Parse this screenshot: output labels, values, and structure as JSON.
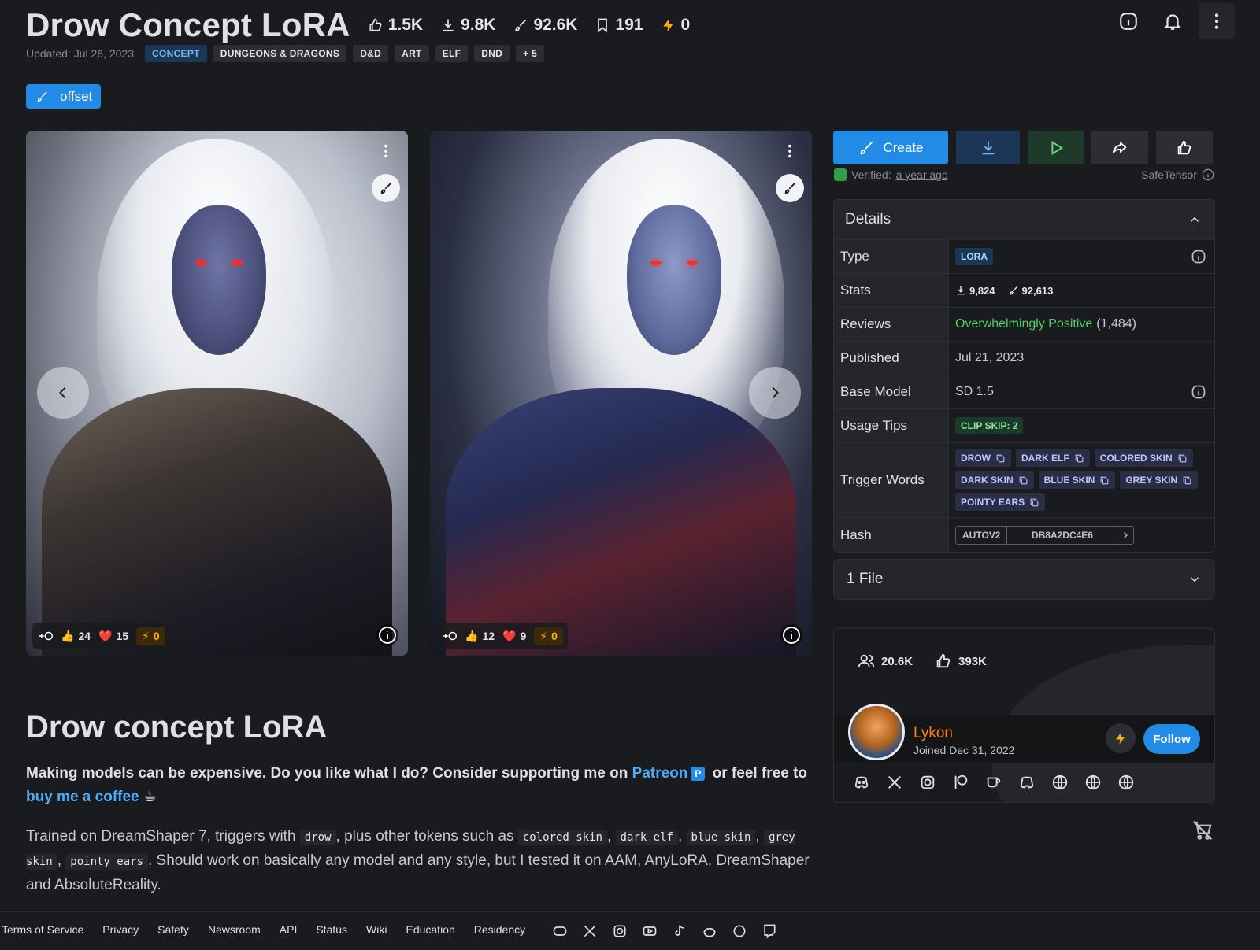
{
  "header": {
    "title": "Drow Concept LoRA",
    "stats": [
      {
        "icon": "thumbs-up-icon",
        "value": "1.5K"
      },
      {
        "icon": "download-icon",
        "value": "9.8K"
      },
      {
        "icon": "brush-icon",
        "value": "92.6K"
      },
      {
        "icon": "bookmark-icon",
        "value": "191"
      },
      {
        "icon": "bolt-icon",
        "value": "0"
      }
    ],
    "updated": "Updated: Jul 26, 2023",
    "tags": [
      "CONCEPT",
      "DUNGEONS & DRAGONS",
      "D&D",
      "ART",
      "ELF",
      "DND",
      "+ 5"
    ],
    "offset_label": "offset"
  },
  "images": [
    {
      "likes": "24",
      "hearts": "15",
      "buzz": "0"
    },
    {
      "likes": "12",
      "hearts": "9",
      "buzz": "0"
    }
  ],
  "description": {
    "title": "Drow concept LoRA",
    "p1_a": "Making models can be expensive. Do you like what I do? Consider supporting me on ",
    "patreon": "Patreon",
    "p_icon": "P",
    "p1_b": " or feel free to ",
    "coffee": "buy me a coffee",
    "coffee_emoji": "☕",
    "p2_a": "Trained on DreamShaper 7, triggers with ",
    "code_drow": "drow",
    "p2_b": ", plus other tokens such as ",
    "code_colored": "colored skin",
    "sep1": ", ",
    "code_dark": "dark elf",
    "sep2": ", ",
    "code_blue": "blue skin",
    "sep3": ", ",
    "code_grey": "grey skin",
    "sep4": ", ",
    "code_pointy": "pointy ears",
    "p2_c": ". Should work on basically any model and any style, but I tested it on AAM, AnyLoRA, DreamShaper and AbsoluteReality."
  },
  "actions": {
    "create": "Create",
    "verified_prefix": "Verified:",
    "verified_time": "a year ago",
    "safetensor": "SafeTensor"
  },
  "details": {
    "title": "Details",
    "type_label": "Type",
    "type_value": "LORA",
    "stats_label": "Stats",
    "stats_downloads": "9,824",
    "stats_generations": "92,613",
    "reviews_label": "Reviews",
    "reviews_value": "Overwhelmingly Positive",
    "reviews_count": "(1,484)",
    "published_label": "Published",
    "published_value": "Jul 21, 2023",
    "base_label": "Base Model",
    "base_value": "SD 1.5",
    "tips_label": "Usage Tips",
    "tips_value": "CLIP SKIP: 2",
    "trigger_label": "Trigger Words",
    "triggers": [
      "DROW",
      "DARK ELF",
      "COLORED SKIN",
      "DARK SKIN",
      "BLUE SKIN",
      "GREY SKIN",
      "POINTY EARS"
    ],
    "hash_label": "Hash",
    "hash_type": "AUTOV2",
    "hash_value": "DB8A2DC4E6"
  },
  "files": {
    "label": "1 File"
  },
  "creator": {
    "followers": "20.6K",
    "likes": "393K",
    "name": "Lykon",
    "joined": "Joined Dec 31, 2022",
    "follow": "Follow"
  },
  "footer": {
    "links": [
      "Terms of Service",
      "Privacy",
      "Safety",
      "Newsroom",
      "API",
      "Status",
      "Wiki",
      "Education",
      "Residency"
    ]
  }
}
